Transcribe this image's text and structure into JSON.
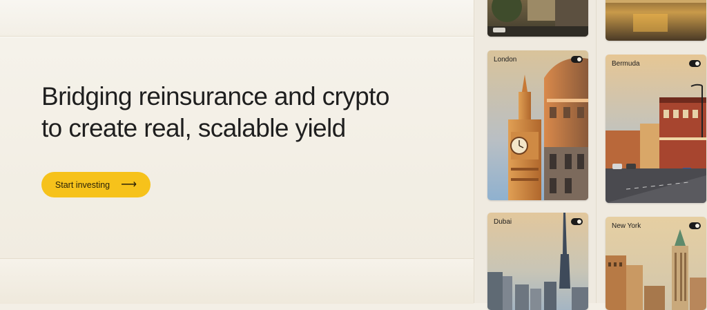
{
  "hero": {
    "headline_line1": "Bridging reinsurance and crypto",
    "headline_line2": "to create real, scalable yield",
    "cta_label": "Start investing",
    "cta_arrow": "⟶"
  },
  "cards": {
    "london": {
      "label": "London",
      "icon": "toggle-icon"
    },
    "bermuda": {
      "label": "Bermuda",
      "icon": "toggle-icon"
    },
    "dubai": {
      "label": "Dubai",
      "icon": "toggle-icon"
    },
    "new_york": {
      "label": "New York",
      "icon": "toggle-icon"
    }
  },
  "colors": {
    "background": "#f3efe6",
    "cta": "#f6c21b",
    "text": "#1f1f1f"
  }
}
